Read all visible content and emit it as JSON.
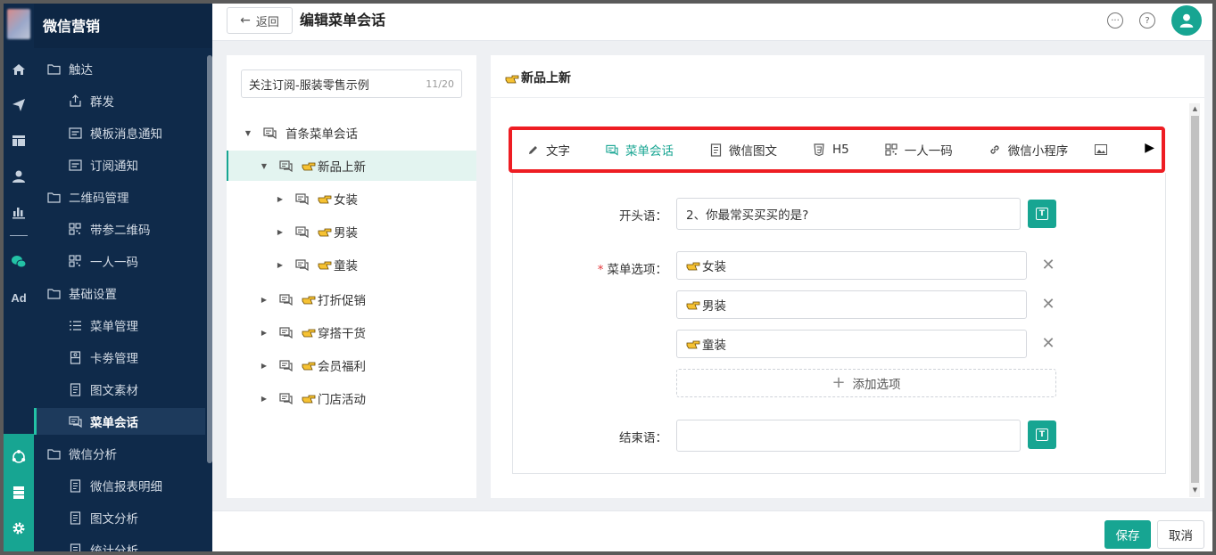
{
  "app": {
    "brand": "微信营销"
  },
  "sidebar": {
    "items": [
      {
        "label": "触达",
        "icon": "folder-icon",
        "type": "group"
      },
      {
        "label": "群发",
        "icon": "broadcast-icon",
        "type": "sub"
      },
      {
        "label": "模板消息通知",
        "icon": "message-card-icon",
        "type": "sub"
      },
      {
        "label": "订阅通知",
        "icon": "message-card-icon",
        "type": "sub"
      },
      {
        "label": "二维码管理",
        "icon": "folder-icon",
        "type": "group"
      },
      {
        "label": "带参二维码",
        "icon": "qrcode-icon",
        "type": "sub"
      },
      {
        "label": "一人一码",
        "icon": "qrcode-icon",
        "type": "sub"
      },
      {
        "label": "基础设置",
        "icon": "folder-icon",
        "type": "group"
      },
      {
        "label": "菜单管理",
        "icon": "list-icon",
        "type": "sub"
      },
      {
        "label": "卡劵管理",
        "icon": "coupon-icon",
        "type": "sub"
      },
      {
        "label": "图文素材",
        "icon": "document-icon",
        "type": "sub"
      },
      {
        "label": "菜单会话",
        "icon": "chat-icon",
        "type": "sub",
        "active": true
      },
      {
        "label": "微信分析",
        "icon": "folder-icon",
        "type": "group"
      },
      {
        "label": "微信报表明细",
        "icon": "document-icon",
        "type": "sub"
      },
      {
        "label": "图文分析",
        "icon": "document-icon",
        "type": "sub"
      },
      {
        "label": "统计分析",
        "icon": "document-icon",
        "type": "sub"
      }
    ]
  },
  "header": {
    "back_label": "返回",
    "title": "编辑菜单会话"
  },
  "tree": {
    "input_value": "关注订阅-服装零售示例",
    "input_count": "11/20",
    "nodes": [
      {
        "label": "首条菜单会话",
        "level": 0,
        "expanded": true,
        "hand": false
      },
      {
        "label": "新品上新",
        "level": 1,
        "expanded": true,
        "hand": true,
        "selected": true
      },
      {
        "label": "女装",
        "level": 2,
        "expanded": false,
        "hand": true
      },
      {
        "label": "男装",
        "level": 2,
        "expanded": false,
        "hand": true
      },
      {
        "label": "童装",
        "level": 2,
        "expanded": false,
        "hand": true
      },
      {
        "label": "打折促销",
        "level": 1,
        "expanded": false,
        "hand": true
      },
      {
        "label": "穿搭干货",
        "level": 1,
        "expanded": false,
        "hand": true
      },
      {
        "label": "会员福利",
        "level": 1,
        "expanded": false,
        "hand": true
      },
      {
        "label": "门店活动",
        "level": 1,
        "expanded": false,
        "hand": true
      }
    ]
  },
  "editor": {
    "heading": "新品上新",
    "tabs": [
      {
        "label": "文字",
        "icon": "pencil-icon"
      },
      {
        "label": "菜单会话",
        "icon": "chat-icon",
        "active": true
      },
      {
        "label": "微信图文",
        "icon": "document-icon"
      },
      {
        "label": "H5",
        "icon": "html5-icon"
      },
      {
        "label": "一人一码",
        "icon": "qrcode-icon"
      },
      {
        "label": "微信小程序",
        "icon": "link-icon"
      }
    ],
    "opening_label": "开头语：",
    "opening_value": "2、你最常买买买的是?",
    "options_label": "菜单选项：",
    "options": [
      "女装",
      "男装",
      "童装"
    ],
    "add_option_label": "添加选项",
    "closing_label": "结束语：",
    "closing_value": ""
  },
  "footer": {
    "save_label": "保存",
    "cancel_label": "取消"
  },
  "colors": {
    "accent": "#17a592",
    "sidebar_bg": "#0f2a4a",
    "highlight_border": "#ee1d23"
  }
}
